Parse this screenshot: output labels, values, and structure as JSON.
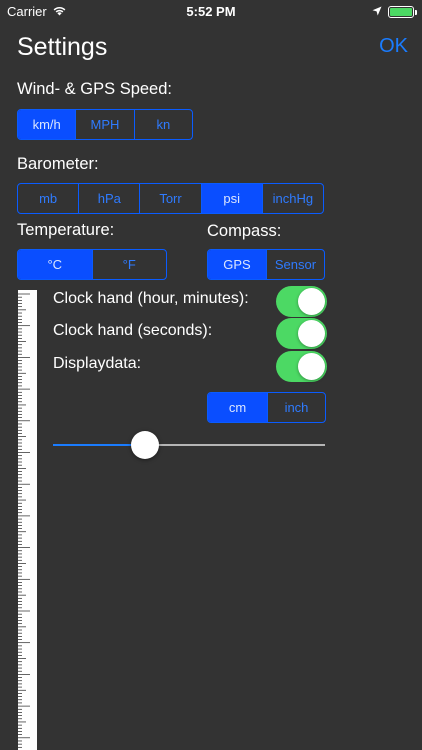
{
  "status_bar": {
    "carrier": "Carrier",
    "time": "5:52 PM",
    "wifi_icon": "wifi-icon",
    "location_icon": "location-arrow-icon",
    "battery_icon": "battery-icon",
    "battery_level": 1.0
  },
  "header": {
    "title": "Settings",
    "ok_label": "OK"
  },
  "wind_speed": {
    "label": "Wind- & GPS Speed:",
    "options": [
      "km/h",
      "MPH",
      "kn"
    ],
    "selected": 0
  },
  "barometer": {
    "label": "Barometer:",
    "options": [
      "mb",
      "hPa",
      "Torr",
      "psi",
      "inchHg"
    ],
    "selected": 3
  },
  "temperature": {
    "label": "Temperature:",
    "options": [
      "°C",
      "°F"
    ],
    "selected": 0
  },
  "compass": {
    "label": "Compass:",
    "options": [
      "GPS",
      "Sensor"
    ],
    "selected": 0
  },
  "switches": [
    {
      "label": "Clock hand (hour, minutes):",
      "on": true
    },
    {
      "label": "Clock hand (seconds):",
      "on": true
    },
    {
      "label": "Displaydata:",
      "on": true
    }
  ],
  "length_unit": {
    "options": [
      "cm",
      "inch"
    ],
    "selected": 0
  },
  "slider": {
    "value": 0.32
  },
  "colors": {
    "accent": "#1a7cff",
    "segment_selected": "#0a4eff",
    "switch_on": "#4cd964",
    "background": "#333333"
  }
}
